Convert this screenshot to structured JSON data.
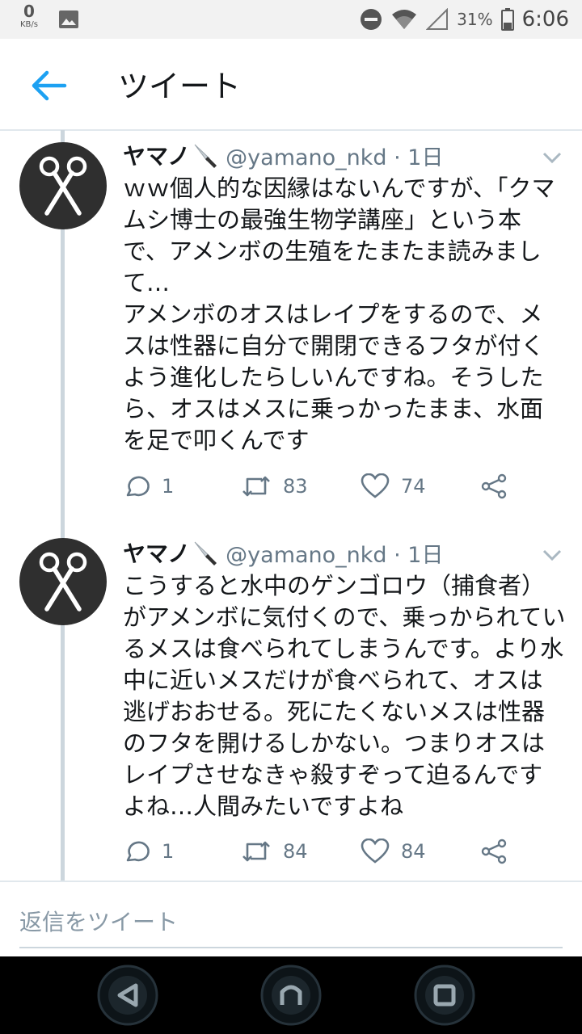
{
  "status_bar": {
    "net_speed_value": "0",
    "net_speed_unit": "KB/s",
    "battery": "31%",
    "time": "6:06"
  },
  "header": {
    "title": "ツイート",
    "back_icon": "arrow-left-icon",
    "accent_color": "#1da1f2"
  },
  "tweets": [
    {
      "name": "ヤマノ",
      "handle_time": "@yamano_nkd · 1日",
      "text": "ｗｗ個人的な因縁はないんですが、「クマムシ博士の最強生物学講座」という本で、アメンボの生殖をたまたま読みまして…\nアメンボのオスはレイプをするので、メスは性器に自分で開閉できるフタが付くよう進化したらしいんですね。そうしたら、オスはメスに乗っかったまま、水面を足で叩くんです",
      "replies": "1",
      "retweets": "83",
      "likes": "74"
    },
    {
      "name": "ヤマノ",
      "handle_time": "@yamano_nkd · 1日",
      "text": "こうすると水中のゲンゴロウ（捕食者）がアメンボに気付くので、乗っかられているメスは食べられてしまうんです。より水中に近いメスだけが食べられて、オスは逃げおおせる。死にたくないメスは性器のフタを開けるしかない。つまりオスはレイプさせなきゃ殺すぞって迫るんですよね…人間みたいですよね",
      "replies": "1",
      "retweets": "84",
      "likes": "84"
    }
  ],
  "reply": {
    "placeholder": "返信をツイート"
  },
  "navbar": {
    "icons": [
      "back-triangle-icon",
      "home-icon",
      "recents-square-icon"
    ]
  }
}
